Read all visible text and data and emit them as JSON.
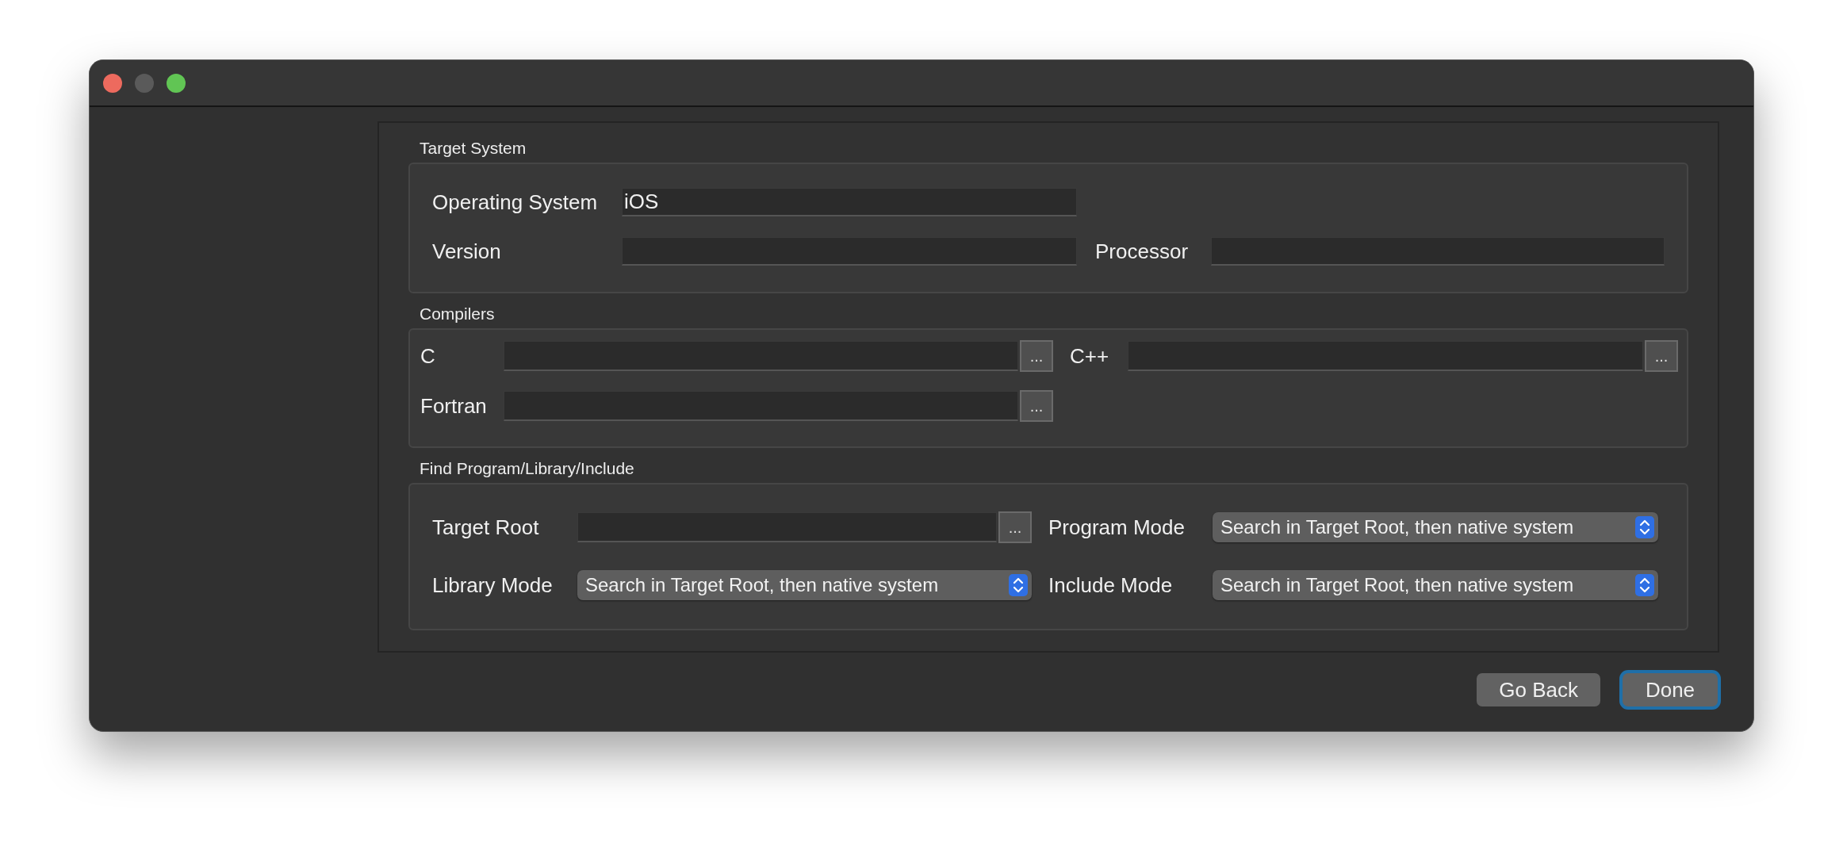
{
  "window": {
    "controls": [
      {
        "kind": "close"
      },
      {
        "kind": "minimize"
      },
      {
        "kind": "zoom"
      }
    ]
  },
  "groups": [
    {
      "title": "Target System",
      "fields": [
        {
          "label": "Operating System",
          "kind": "text",
          "value": "iOS"
        },
        {
          "kind": "blank"
        },
        {
          "label": "Version",
          "kind": "text"
        },
        {
          "label": "Processor",
          "kind": "text"
        }
      ]
    },
    {
      "title": "Compilers",
      "fields": [
        {
          "label": "C",
          "kind": "path",
          "button": "..."
        },
        {
          "label": "C++",
          "kind": "path",
          "button": "..."
        },
        {
          "label": "Fortran",
          "kind": "path",
          "button": "..."
        }
      ]
    },
    {
      "title": "Find Program/Library/Include",
      "fields": [
        {
          "label": "Target Root",
          "kind": "path",
          "button": "..."
        },
        {
          "label": "Program Mode",
          "kind": "select",
          "value": "Search in Target Root, then native system"
        },
        {
          "label": "Library Mode",
          "kind": "select",
          "value": "Search in Target Root, then native system"
        },
        {
          "label": "Include Mode",
          "kind": "select",
          "value": "Search in Target Root, then native system"
        }
      ]
    }
  ],
  "buttons": [
    {
      "label": "Go Back",
      "default": false
    },
    {
      "label": "Done",
      "default": true
    }
  ]
}
